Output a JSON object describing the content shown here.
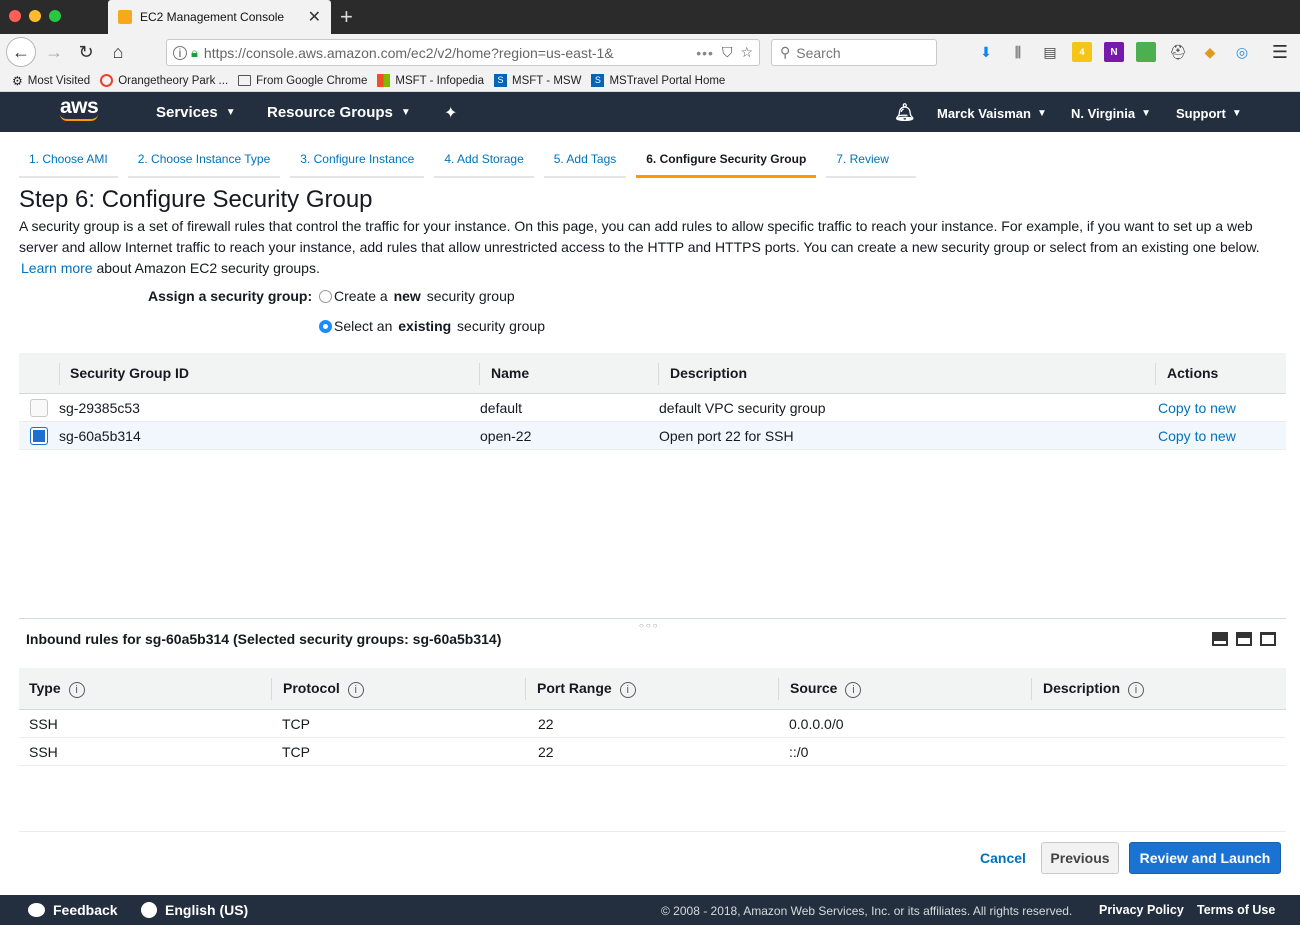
{
  "browser": {
    "tab_title": "EC2 Management Console",
    "url": "https://console.aws.amazon.com/ec2/v2/home?region=us-east-1&",
    "search_placeholder": "Search",
    "badge_count": "4",
    "bookmarks": [
      {
        "label": "Most Visited",
        "icon": "gear-icon"
      },
      {
        "label": "Orangetheory Park ...",
        "icon": "orangetheory-icon"
      },
      {
        "label": "From Google Chrome",
        "icon": "folder-icon"
      },
      {
        "label": "MSFT - Infopedia",
        "icon": "microsoft-icon"
      },
      {
        "label": "MSFT - MSW",
        "icon": "sharepoint-icon"
      },
      {
        "label": "MSTravel Portal Home",
        "icon": "sharepoint-icon"
      }
    ]
  },
  "aws_header": {
    "logo": "aws",
    "services": "Services",
    "resource_groups": "Resource Groups",
    "user": "Marck Vaisman",
    "region": "N. Virginia",
    "support": "Support"
  },
  "steps": [
    {
      "label": "1. Choose AMI",
      "active": false
    },
    {
      "label": "2. Choose Instance Type",
      "active": false
    },
    {
      "label": "3. Configure Instance",
      "active": false
    },
    {
      "label": "4. Add Storage",
      "active": false
    },
    {
      "label": "5. Add Tags",
      "active": false
    },
    {
      "label": "6. Configure Security Group",
      "active": true
    },
    {
      "label": "7. Review",
      "active": false
    }
  ],
  "page": {
    "title": "Step 6: Configure Security Group",
    "intro": "A security group is a set of firewall rules that control the traffic for your instance. On this page, you can add rules to allow specific traffic to reach your instance. For example, if you want to set up a web server and allow Internet traffic to reach your instance, add rules that allow unrestricted access to the HTTP and HTTPS ports. You can create a new security group or select from an existing one below.",
    "learn_more": "Learn more",
    "learn_more_suffix": "about Amazon EC2 security groups."
  },
  "assign": {
    "label": "Assign a security group:",
    "option_create_pre": "Create a ",
    "option_create_bold": "new",
    "option_create_post": " security group",
    "option_select_pre": "Select an ",
    "option_select_bold": "existing",
    "option_select_post": " security group",
    "selected": "existing"
  },
  "sg_table": {
    "headers": {
      "id": "Security Group ID",
      "name": "Name",
      "description": "Description",
      "actions": "Actions"
    },
    "rows": [
      {
        "id": "sg-29385c53",
        "name": "default",
        "description": "default VPC security group",
        "action": "Copy to new",
        "checked": false
      },
      {
        "id": "sg-60a5b314",
        "name": "open-22",
        "description": "Open port 22 for SSH",
        "action": "Copy to new",
        "checked": true
      }
    ]
  },
  "inbound": {
    "title": "Inbound rules for sg-60a5b314 (Selected security groups: sg-60a5b314)",
    "headers": {
      "type": "Type",
      "protocol": "Protocol",
      "port_range": "Port Range",
      "source": "Source",
      "description": "Description"
    },
    "info_glyph": "i",
    "rows": [
      {
        "type": "SSH",
        "protocol": "TCP",
        "port_range": "22",
        "source": "0.0.0.0/0",
        "description": ""
      },
      {
        "type": "SSH",
        "protocol": "TCP",
        "port_range": "22",
        "source": "::/0",
        "description": ""
      }
    ]
  },
  "actions": {
    "cancel": "Cancel",
    "previous": "Previous",
    "review_launch": "Review and Launch"
  },
  "footer": {
    "feedback": "Feedback",
    "language": "English (US)",
    "copyright": "© 2008 - 2018, Amazon Web Services, Inc. or its affiliates. All rights reserved.",
    "privacy": "Privacy Policy",
    "terms": "Terms of Use"
  },
  "colors": {
    "aws_header": "#232f3e",
    "accent_orange": "#ff9900",
    "link_blue": "#0073bb",
    "primary_button": "#1a73d3"
  }
}
